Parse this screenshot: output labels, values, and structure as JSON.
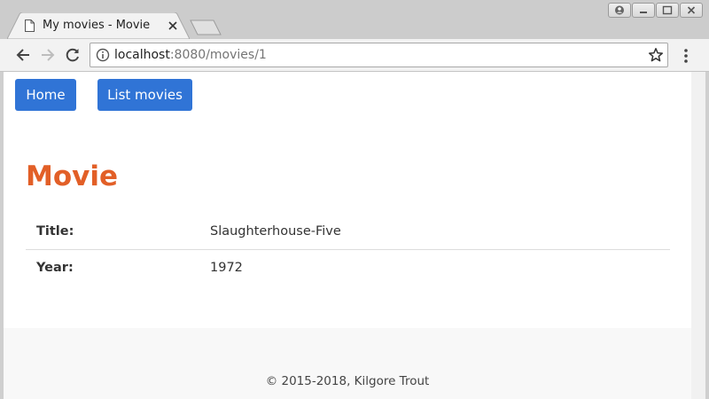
{
  "browser": {
    "tab": {
      "title": "My movies - Movie",
      "page_icon": "document-icon",
      "close_icon": "close-icon"
    },
    "new_tab_icon": "new-tab-icon",
    "window_controls": [
      "account-icon",
      "minimize-icon",
      "maximize-icon",
      "close-icon"
    ],
    "toolbar": {
      "back_icon": "arrow-left-icon",
      "forward_icon": "arrow-right-icon",
      "reload_icon": "reload-icon",
      "info_icon": "info-icon",
      "bookmark_icon": "star-icon",
      "menu_icon": "kebab-menu-icon"
    },
    "address": {
      "host": "localhost",
      "rest": ":8080/movies/1"
    }
  },
  "nav": {
    "home_label": "Home",
    "list_label": "List movies"
  },
  "page": {
    "heading": "Movie",
    "details": [
      {
        "label": "Title:",
        "value": "Slaughterhouse-Five"
      },
      {
        "label": "Year:",
        "value": "1972"
      }
    ]
  },
  "footer": {
    "text": "© 2015-2018, Kilgore Trout"
  },
  "colors": {
    "accent": "#3074d6",
    "heading": "#e25f27",
    "footer_bg": "#f8f8f8"
  }
}
